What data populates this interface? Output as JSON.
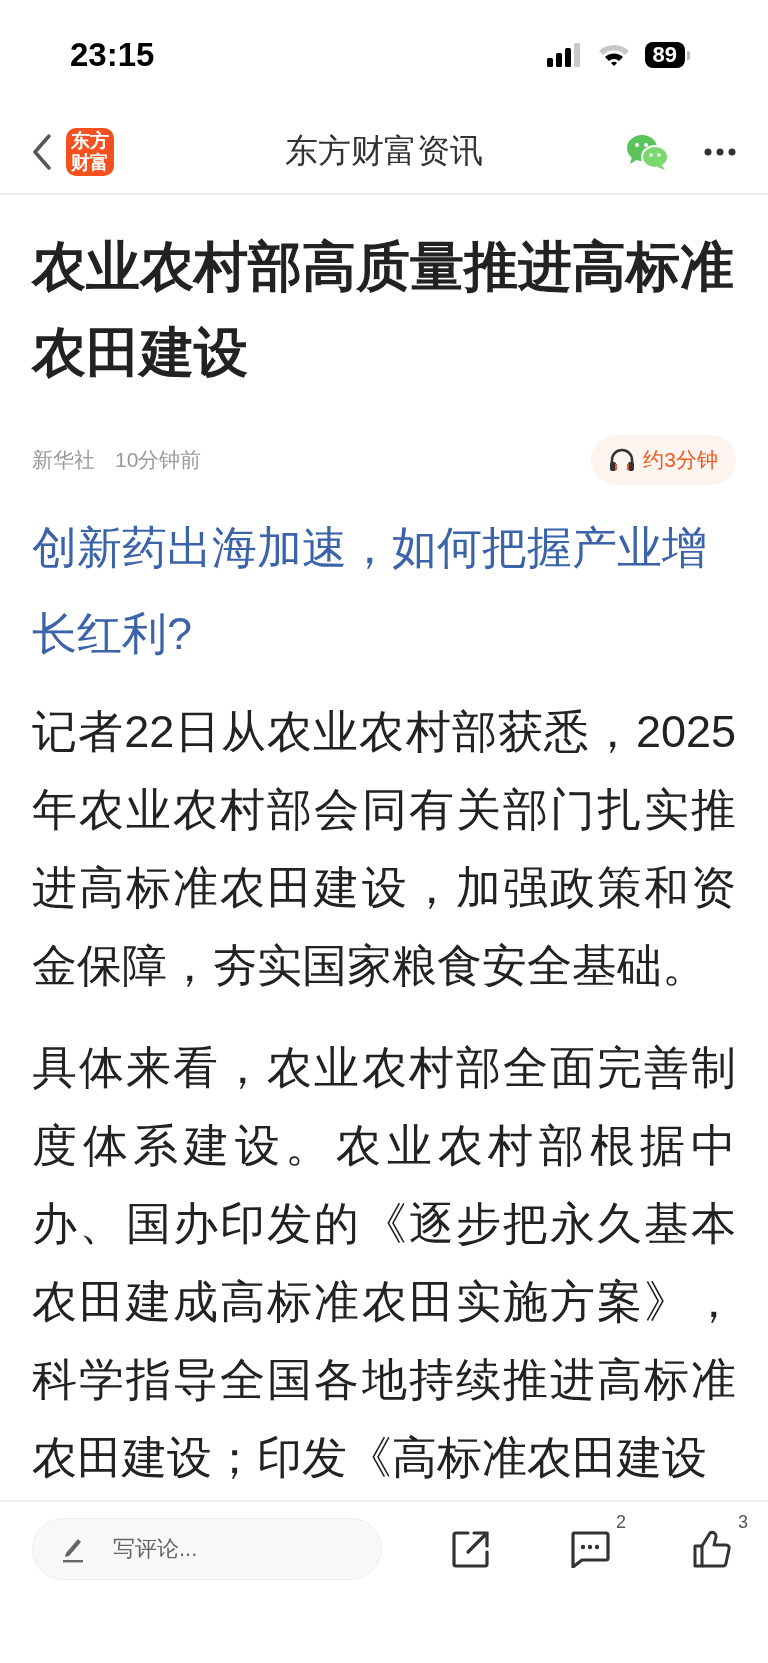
{
  "status_bar": {
    "time": "23:15",
    "battery": "89"
  },
  "nav": {
    "logo": "东方财富",
    "title": "东方财富资讯"
  },
  "article": {
    "title": "农业农村部高质量推进高标准农田建设",
    "source": "新华社",
    "time": "10分钟前",
    "listen": "约3分钟",
    "promo_link": "创新药出海加速，如何把握产业增长红利?",
    "paragraphs": [
      "记者22日从农业农村部获悉，2025年农业农村部会同有关部门扎实推进高标准农田建设，加强政策和资金保障，夯实国家粮食安全基础。",
      "具体来看，农业农村部全面完善制度体系建设。农业农村部根据中办、国办印发的《逐步把永久基本农田建成高标准农田实施方案》，科学指导全国各地持续推进高标准农田建设；印发《高标准农田建设"
    ]
  },
  "bottom_bar": {
    "comment_placeholder": "写评论...",
    "comment_count": "2",
    "like_count": "3"
  }
}
